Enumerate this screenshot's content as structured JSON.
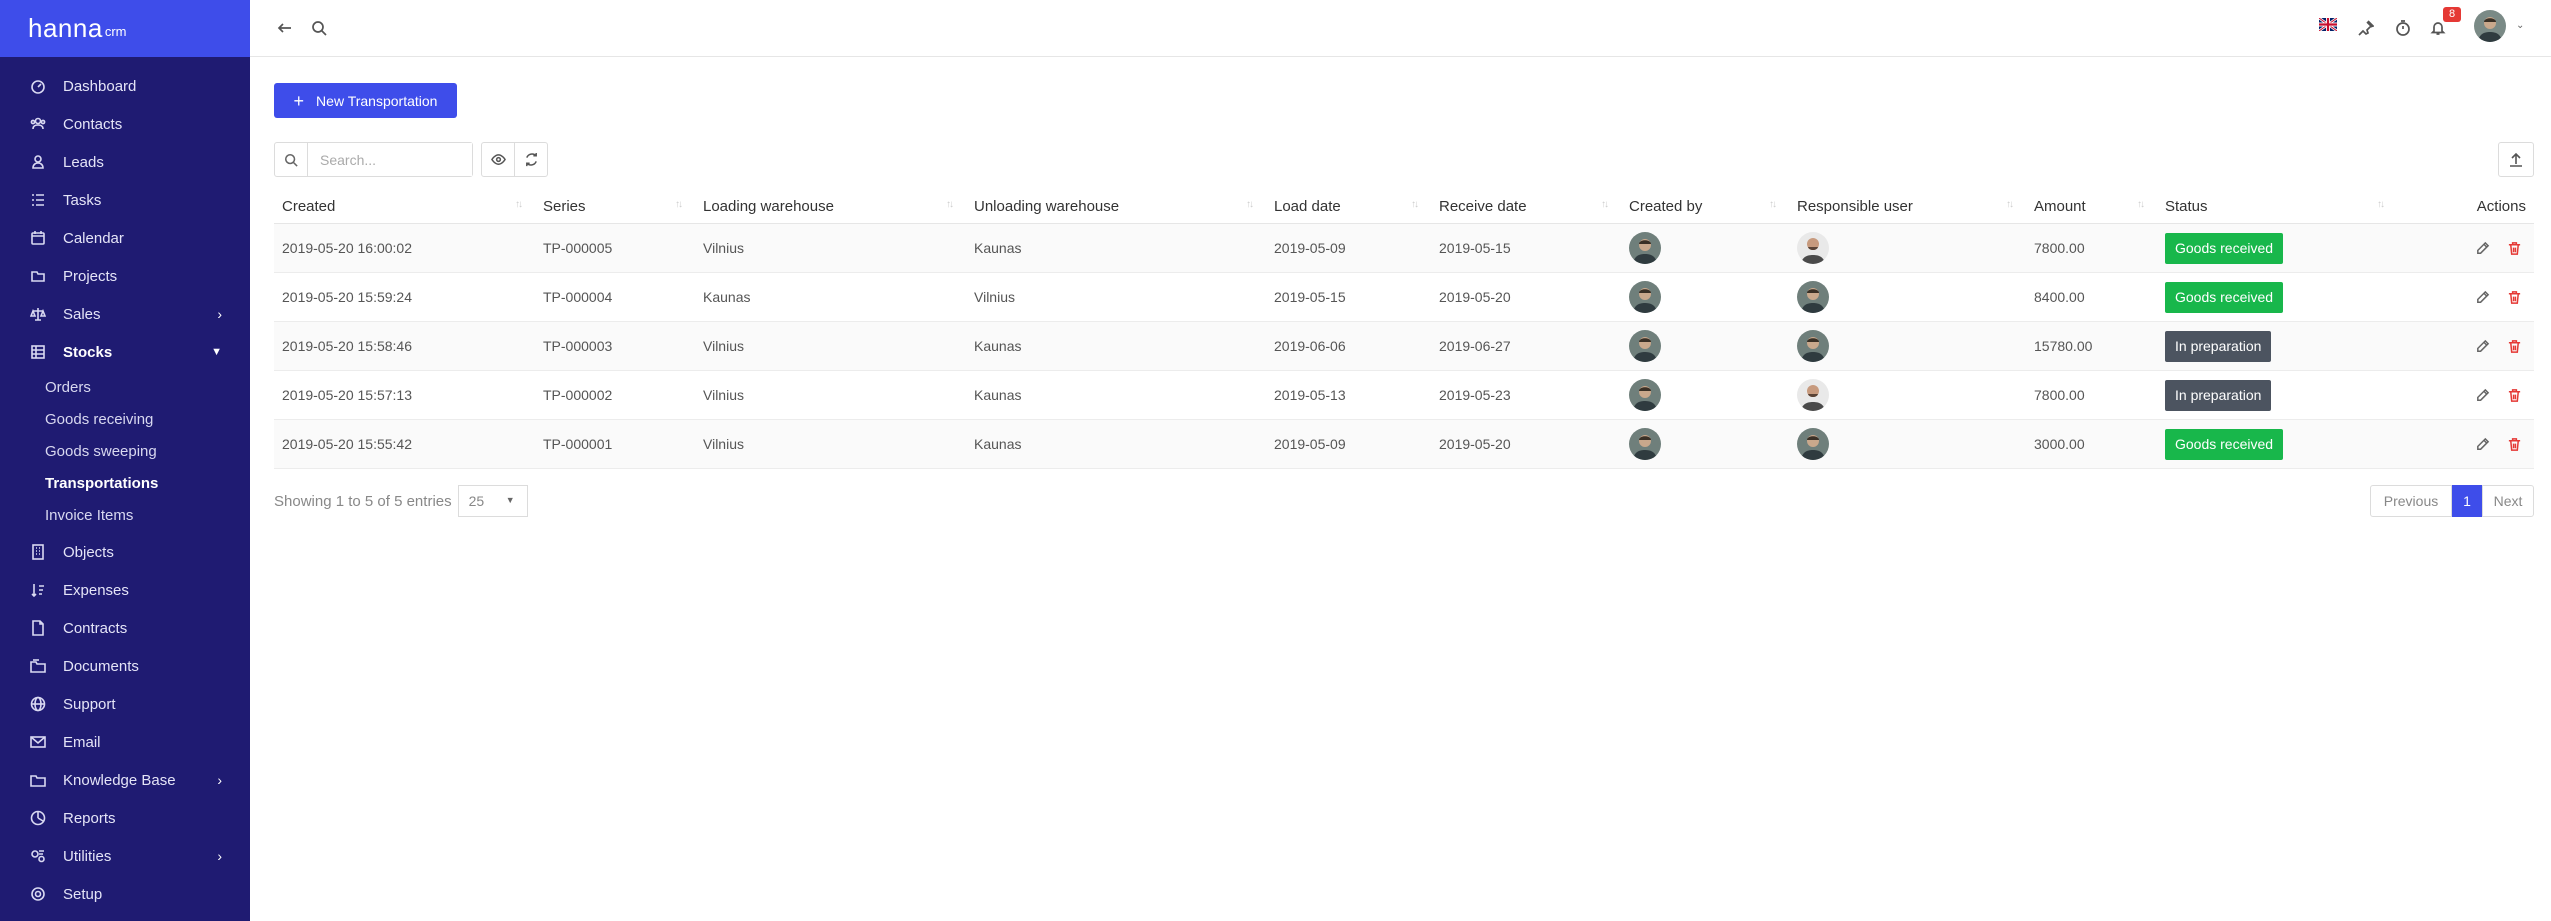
{
  "brand": {
    "name": "hanna",
    "suffix": "crm"
  },
  "sidebar": {
    "items": [
      {
        "label": "Dashboard",
        "icon": "dashboard-icon"
      },
      {
        "label": "Contacts",
        "icon": "contacts-icon"
      },
      {
        "label": "Leads",
        "icon": "leads-icon"
      },
      {
        "label": "Tasks",
        "icon": "tasks-icon"
      },
      {
        "label": "Calendar",
        "icon": "calendar-icon"
      },
      {
        "label": "Projects",
        "icon": "projects-icon"
      },
      {
        "label": "Sales",
        "icon": "sales-icon",
        "expandable": true
      },
      {
        "label": "Stocks",
        "icon": "stocks-icon",
        "expanded": true
      },
      {
        "label": "Objects",
        "icon": "objects-icon"
      },
      {
        "label": "Expenses",
        "icon": "expenses-icon"
      },
      {
        "label": "Contracts",
        "icon": "contracts-icon"
      },
      {
        "label": "Documents",
        "icon": "documents-icon"
      },
      {
        "label": "Support",
        "icon": "support-icon"
      },
      {
        "label": "Email",
        "icon": "email-icon"
      },
      {
        "label": "Knowledge Base",
        "icon": "knowledge-base-icon",
        "expandable": true
      },
      {
        "label": "Reports",
        "icon": "reports-icon"
      },
      {
        "label": "Utilities",
        "icon": "utilities-icon",
        "expandable": true
      },
      {
        "label": "Setup",
        "icon": "setup-icon"
      }
    ],
    "stocks_sub": [
      "Orders",
      "Goods receiving",
      "Goods sweeping",
      "Transportations",
      "Invoice Items"
    ],
    "active_sub": "Transportations"
  },
  "topbar": {
    "notification_count": "8",
    "icons": [
      "back-arrow-icon",
      "search-icon",
      "uk-flag-icon",
      "pin-icon",
      "timer-icon",
      "bell-icon",
      "avatar"
    ]
  },
  "toolbar": {
    "new_button": "New Transportation",
    "search_placeholder": "Search..."
  },
  "table": {
    "columns": [
      "Created",
      "Series",
      "Loading warehouse",
      "Unloading warehouse",
      "Load date",
      "Receive date",
      "Created by",
      "Responsible user",
      "Amount",
      "Status",
      "Actions"
    ],
    "rows": [
      {
        "created": "2019-05-20 16:00:02",
        "series": "TP-000005",
        "loading": "Vilnius",
        "unloading": "Kaunas",
        "load_date": "2019-05-09",
        "receive_date": "2019-05-15",
        "amount": "7800.00",
        "status": "Goods received",
        "status_type": "received",
        "resp_avatar": "bald"
      },
      {
        "created": "2019-05-20 15:59:24",
        "series": "TP-000004",
        "loading": "Kaunas",
        "unloading": "Vilnius",
        "load_date": "2019-05-15",
        "receive_date": "2019-05-20",
        "amount": "8400.00",
        "status": "Goods received",
        "status_type": "received",
        "resp_avatar": "dark"
      },
      {
        "created": "2019-05-20 15:58:46",
        "series": "TP-000003",
        "loading": "Vilnius",
        "unloading": "Kaunas",
        "load_date": "2019-06-06",
        "receive_date": "2019-06-27",
        "amount": "15780.00",
        "status": "In preparation",
        "status_type": "prep",
        "resp_avatar": "dark"
      },
      {
        "created": "2019-05-20 15:57:13",
        "series": "TP-000002",
        "loading": "Vilnius",
        "unloading": "Kaunas",
        "load_date": "2019-05-13",
        "receive_date": "2019-05-23",
        "amount": "7800.00",
        "status": "In preparation",
        "status_type": "prep",
        "resp_avatar": "bald"
      },
      {
        "created": "2019-05-20 15:55:42",
        "series": "TP-000001",
        "loading": "Vilnius",
        "unloading": "Kaunas",
        "load_date": "2019-05-09",
        "receive_date": "2019-05-20",
        "amount": "3000.00",
        "status": "Goods received",
        "status_type": "received",
        "resp_avatar": "dark"
      }
    ]
  },
  "footer": {
    "info": "Showing 1 to 5 of 5 entries",
    "page_size": "25",
    "previous": "Previous",
    "current_page": "1",
    "next": "Next"
  },
  "colors": {
    "sidebar": "#1f1b72",
    "accent": "#3e4dea",
    "status_received": "#18b74b",
    "status_prep": "#4c5460",
    "delete": "#e53935"
  }
}
